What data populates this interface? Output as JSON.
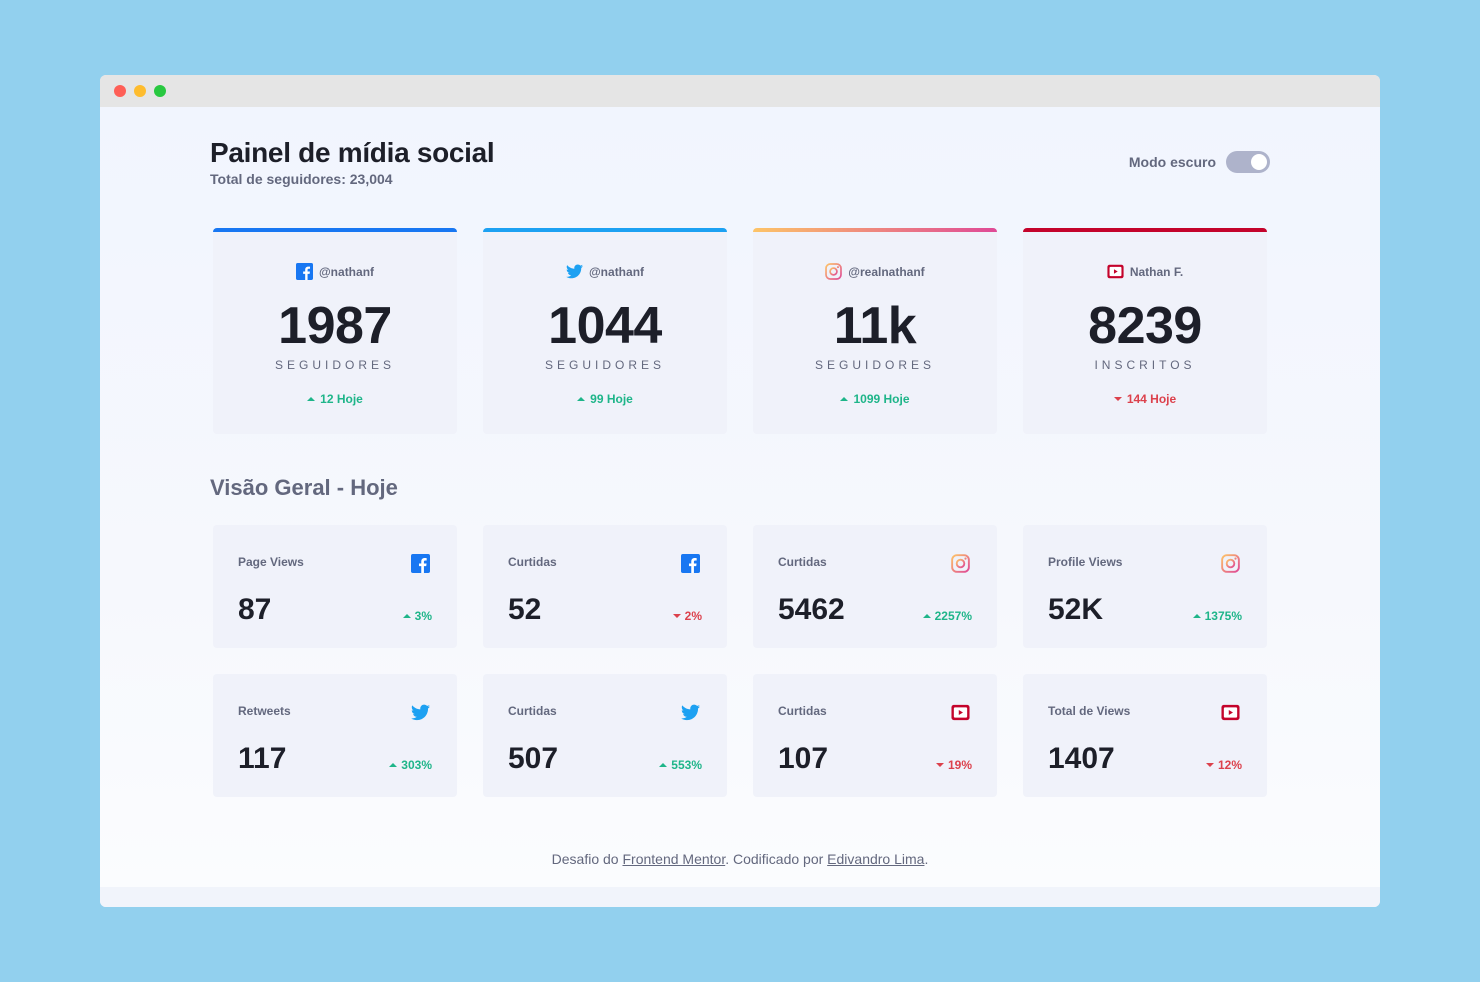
{
  "page": {
    "title": "Painel de mídia social",
    "total_followers": "Total de seguidores: 23,004",
    "dark_mode_label": "Modo escuro"
  },
  "colors": {
    "facebook": "#1877f2",
    "twitter": "#1da1f2",
    "instagram_gradient": [
      "#fdc468",
      "#df4996"
    ],
    "youtube": "#c4032b",
    "up": "#1eb589",
    "down": "#dc414c"
  },
  "followers": [
    {
      "network": "facebook",
      "icon": "facebook-icon",
      "handle": "@nathanf",
      "count": "1987",
      "label": "SEGUIDORES",
      "change": "12 Hoje",
      "trend": "up"
    },
    {
      "network": "twitter",
      "icon": "twitter-icon",
      "handle": "@nathanf",
      "count": "1044",
      "label": "SEGUIDORES",
      "change": "99 Hoje",
      "trend": "up"
    },
    {
      "network": "instagram",
      "icon": "instagram-icon",
      "handle": "@realnathanf",
      "count": "11k",
      "label": "SEGUIDORES",
      "change": "1099 Hoje",
      "trend": "up"
    },
    {
      "network": "youtube",
      "icon": "youtube-icon",
      "handle": "Nathan F.",
      "count": "8239",
      "label": "INSCRITOS",
      "change": "144 Hoje",
      "trend": "down"
    }
  ],
  "overview": {
    "title": "Visão Geral - Hoje",
    "cards": [
      {
        "metric": "Page Views",
        "network": "facebook",
        "value": "87",
        "change": "3%",
        "trend": "up"
      },
      {
        "metric": "Curtidas",
        "network": "facebook",
        "value": "52",
        "change": "2%",
        "trend": "down"
      },
      {
        "metric": "Curtidas",
        "network": "instagram",
        "value": "5462",
        "change": "2257%",
        "trend": "up"
      },
      {
        "metric": "Profile Views",
        "network": "instagram",
        "value": "52K",
        "change": "1375%",
        "trend": "up"
      },
      {
        "metric": "Retweets",
        "network": "twitter",
        "value": "117",
        "change": "303%",
        "trend": "up"
      },
      {
        "metric": "Curtidas",
        "network": "twitter",
        "value": "507",
        "change": "553%",
        "trend": "up"
      },
      {
        "metric": "Curtidas",
        "network": "youtube",
        "value": "107",
        "change": "19%",
        "trend": "down"
      },
      {
        "metric": "Total de Views",
        "network": "youtube",
        "value": "1407",
        "change": "12%",
        "trend": "down"
      }
    ]
  },
  "footer": {
    "prefix": "Desafio do ",
    "link1": "Frontend Mentor",
    "middle": ". Codificado por ",
    "link2": "Edivandro Lima",
    "suffix": "."
  }
}
